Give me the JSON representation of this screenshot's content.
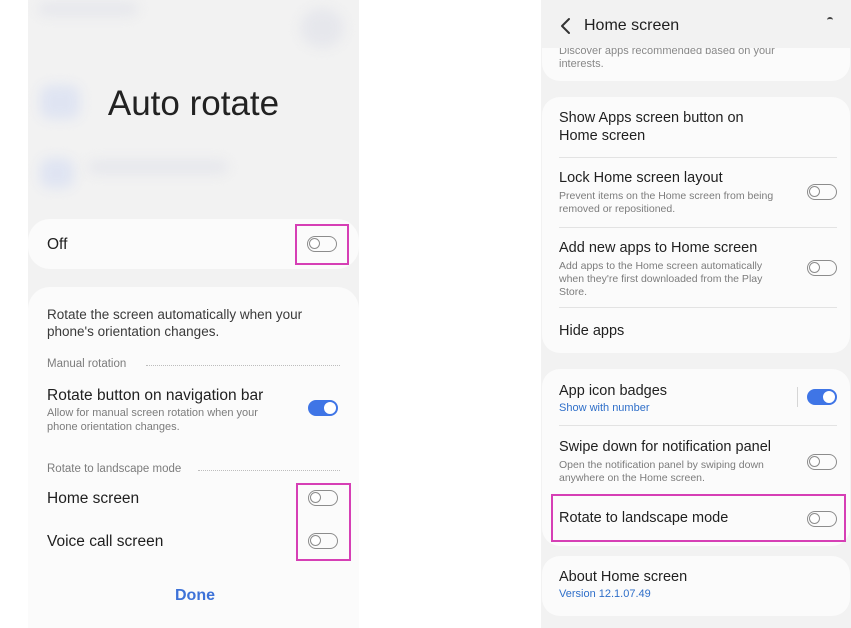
{
  "left": {
    "dialog_title": "Auto rotate",
    "master": {
      "label": "Off",
      "state": "off"
    },
    "description": "Rotate the screen automatically when your phone's orientation changes.",
    "manual_section": "Manual rotation",
    "rotate_button": {
      "title": "Rotate button on navigation bar",
      "subtitle": "Allow for manual screen rotation when your phone orientation changes.",
      "state": "on"
    },
    "landscape_section": "Rotate to landscape mode",
    "home_screen": {
      "label": "Home screen",
      "state": "off"
    },
    "voice_call": {
      "label": "Voice call screen",
      "state": "off"
    },
    "done_label": "Done"
  },
  "right": {
    "header_title": "Home screen",
    "top_partial_text_1": "Discover apps recommended based on your",
    "top_partial_text_2": "interests.",
    "items": {
      "show_apps": {
        "title": "Show Apps screen button on Home screen"
      },
      "lock_layout": {
        "title": "Lock Home screen layout",
        "subtitle": "Prevent items on the Home screen from being removed or repositioned.",
        "state": "off"
      },
      "add_new_apps": {
        "title": "Add new apps to Home screen",
        "subtitle": "Add apps to the Home screen automatically when they're first downloaded from the Play Store.",
        "state": "off"
      },
      "hide_apps": {
        "title": "Hide apps"
      },
      "app_icon_badges": {
        "title": "App icon badges",
        "subtitle": "Show with number",
        "state": "on"
      },
      "swipe_down": {
        "title": "Swipe down for notification panel",
        "subtitle": "Open the notification panel by swiping down anywhere on the Home screen.",
        "state": "off"
      },
      "rotate_landscape": {
        "title": "Rotate to landscape mode",
        "state": "off"
      },
      "about": {
        "title": "About Home screen",
        "subtitle": "Version 12.1.07.49"
      }
    }
  },
  "colors": {
    "accent": "#3f75e6",
    "highlight": "#d63fb5",
    "link": "#2f6fc9"
  },
  "icons": [
    "back-chevron-icon",
    "toggle-switch-icon"
  ]
}
